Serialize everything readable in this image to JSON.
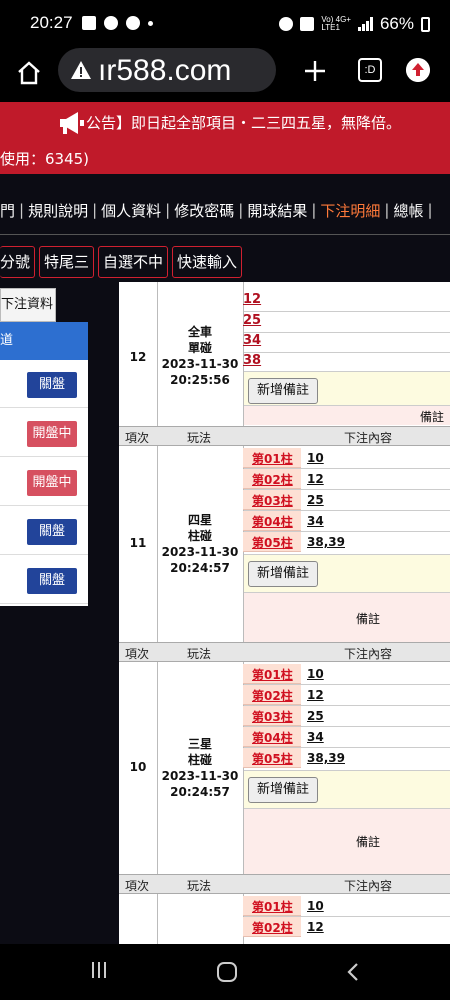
{
  "status_bar": {
    "time": "20:27",
    "network_top": "Vo) 4G+",
    "network_bottom": "LTE1",
    "battery": "66%",
    "icons": [
      "image-icon",
      "chrome-icon",
      "cloud-icon",
      "dot-icon",
      "alarm-icon",
      "wifi-call-icon",
      "signal-icon",
      "battery-icon"
    ]
  },
  "browser": {
    "url": "ır588.com",
    "tabs_label": ":D",
    "icons": [
      "home-icon",
      "warning-icon",
      "plus-icon",
      "tabs-icon",
      "update-icon"
    ]
  },
  "announcement": {
    "line1": "公告】即日起全部項目・二三四五星，無降倍。",
    "line2": "使用：6345)"
  },
  "nav_menu": {
    "items": [
      {
        "label": "門",
        "active": false
      },
      {
        "label": "規則說明",
        "active": false
      },
      {
        "label": "個人資料",
        "active": false
      },
      {
        "label": "修改密碼",
        "active": false
      },
      {
        "label": "開球結果",
        "active": false
      },
      {
        "label": "下注明細",
        "active": true
      },
      {
        "label": "總帳",
        "active": false
      }
    ]
  },
  "quick_buttons": [
    "分號",
    "特尾三",
    "自選不中",
    "快速輸入"
  ],
  "left_panel": {
    "header": "下注資料",
    "bluebar_label": "道",
    "rows": [
      {
        "status": "關盤",
        "color": "blue"
      },
      {
        "status": "開盤中",
        "color": "red"
      },
      {
        "status": "開盤中",
        "color": "red"
      },
      {
        "status": "關盤",
        "color": "blue"
      },
      {
        "status": "關盤",
        "color": "blue"
      }
    ]
  },
  "table": {
    "headers": {
      "no": "項次",
      "type": "玩法",
      "content": "下注內容"
    },
    "add_note_label": "新增備註",
    "remark_label": "備註",
    "records": [
      {
        "no": "12",
        "type_lines": [
          "全車",
          "單碰"
        ],
        "date": "2023-11-30",
        "time": "20:25:56",
        "numbers": [
          "12",
          "25",
          "34",
          "38"
        ]
      },
      {
        "no": "11",
        "type_lines": [
          "四星",
          "柱碰"
        ],
        "date": "2023-11-30",
        "time": "20:24:57",
        "columns": [
          {
            "label": "第01柱",
            "value": "10"
          },
          {
            "label": "第02柱",
            "value": "12"
          },
          {
            "label": "第03柱",
            "value": "25"
          },
          {
            "label": "第04柱",
            "value": "34"
          },
          {
            "label": "第05柱",
            "value": "38,39"
          }
        ]
      },
      {
        "no": "10",
        "type_lines": [
          "三星",
          "柱碰"
        ],
        "date": "2023-11-30",
        "time": "20:24:57",
        "columns": [
          {
            "label": "第01柱",
            "value": "10"
          },
          {
            "label": "第02柱",
            "value": "12"
          },
          {
            "label": "第03柱",
            "value": "25"
          },
          {
            "label": "第04柱",
            "value": "34"
          },
          {
            "label": "第05柱",
            "value": "38,39"
          }
        ]
      },
      {
        "columns": [
          {
            "label": "第01柱",
            "value": "10"
          },
          {
            "label": "第02柱",
            "value": "12"
          }
        ]
      }
    ]
  },
  "android_nav": {
    "icons": [
      "recent-apps-icon",
      "home-circle-icon",
      "back-icon"
    ]
  }
}
